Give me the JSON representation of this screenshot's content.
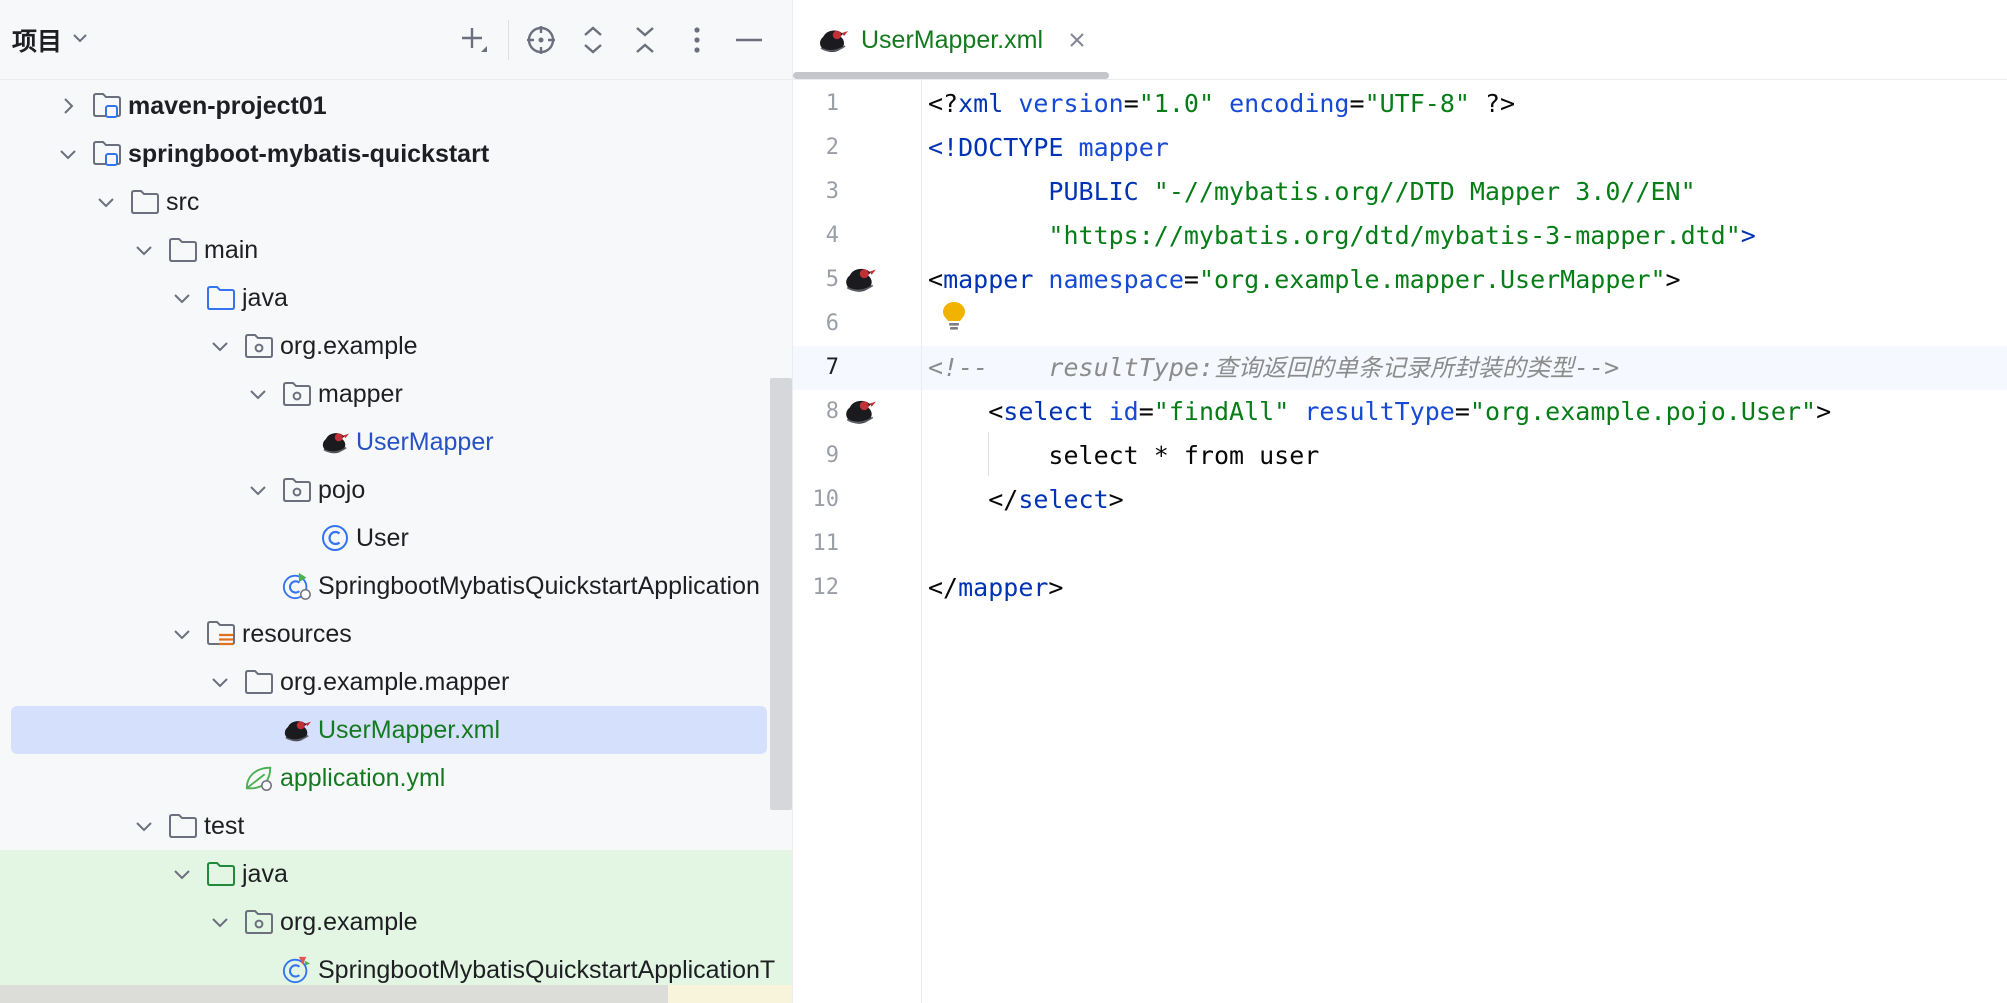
{
  "project_panel": {
    "title": "项目",
    "toolbar": [
      {
        "name": "add-icon"
      },
      {
        "name": "locate-icon"
      },
      {
        "name": "expand-all-icon"
      },
      {
        "name": "collapse-all-icon"
      },
      {
        "name": "more-options-icon"
      },
      {
        "name": "minimize-icon"
      }
    ],
    "tree": [
      {
        "label": "maven-project01",
        "depth": 0,
        "expand": "collapsed",
        "icon": "module-folder-icon",
        "style": "bold"
      },
      {
        "label": "springboot-mybatis-quickstart",
        "depth": 0,
        "expand": "expanded",
        "icon": "module-folder-icon",
        "style": "bold"
      },
      {
        "label": "src",
        "depth": 1,
        "expand": "expanded",
        "icon": "folder-icon",
        "style": "normal"
      },
      {
        "label": "main",
        "depth": 2,
        "expand": "expanded",
        "icon": "folder-icon",
        "style": "normal"
      },
      {
        "label": "java",
        "depth": 3,
        "expand": "expanded",
        "icon": "source-folder-icon",
        "style": "normal"
      },
      {
        "label": "org.example",
        "depth": 4,
        "expand": "expanded",
        "icon": "package-icon",
        "style": "normal"
      },
      {
        "label": "mapper",
        "depth": 5,
        "expand": "expanded",
        "icon": "package-icon",
        "style": "normal"
      },
      {
        "label": "UserMapper",
        "depth": 6,
        "expand": "none",
        "icon": "mybatis-bird-icon",
        "style": "blue"
      },
      {
        "label": "pojo",
        "depth": 5,
        "expand": "expanded",
        "icon": "package-icon",
        "style": "normal"
      },
      {
        "label": "User",
        "depth": 6,
        "expand": "none",
        "icon": "class-icon",
        "style": "normal"
      },
      {
        "label": "SpringbootMybatisQuickstartApplication",
        "depth": 5,
        "expand": "none",
        "icon": "spring-boot-class-icon",
        "style": "normal"
      },
      {
        "label": "resources",
        "depth": 3,
        "expand": "expanded",
        "icon": "resources-folder-icon",
        "style": "normal"
      },
      {
        "label": "org.example.mapper",
        "depth": 4,
        "expand": "expanded",
        "icon": "folder-icon",
        "style": "normal"
      },
      {
        "label": "UserMapper.xml",
        "depth": 5,
        "expand": "none",
        "icon": "mybatis-bird-icon",
        "style": "green",
        "selected": true
      },
      {
        "label": "application.yml",
        "depth": 4,
        "expand": "none",
        "icon": "spring-config-icon",
        "style": "green"
      },
      {
        "label": "test",
        "depth": 2,
        "expand": "expanded",
        "icon": "folder-icon",
        "style": "normal"
      },
      {
        "label": "java",
        "depth": 3,
        "expand": "expanded",
        "icon": "test-folder-icon",
        "style": "normal",
        "highlight": "green"
      },
      {
        "label": "org.example",
        "depth": 4,
        "expand": "expanded",
        "icon": "package-icon",
        "style": "normal",
        "highlight": "green"
      },
      {
        "label": "SpringbootMybatisQuickstartApplicationT",
        "depth": 5,
        "expand": "none",
        "icon": "spring-boot-test-icon",
        "style": "normal",
        "highlight": "green"
      }
    ]
  },
  "editor": {
    "tab": {
      "label": "UserMapper.xml",
      "close": "close-icon"
    },
    "current_line": 7,
    "lines": [
      {
        "n": "1",
        "tokens": [
          {
            "t": "<?",
            "c": ""
          },
          {
            "t": "xml ",
            "c": "tag"
          },
          {
            "t": "version",
            "c": "attr"
          },
          {
            "t": "=",
            "c": ""
          },
          {
            "t": "\"1.0\"",
            "c": "val"
          },
          {
            "t": " ",
            "c": ""
          },
          {
            "t": "encoding",
            "c": "attr"
          },
          {
            "t": "=",
            "c": ""
          },
          {
            "t": "\"UTF-8\"",
            "c": "val"
          },
          {
            "t": " ?>",
            "c": ""
          }
        ]
      },
      {
        "n": "2",
        "tokens": [
          {
            "t": "<!DOCTYPE ",
            "c": "tag"
          },
          {
            "t": "mapper",
            "c": "attr"
          }
        ]
      },
      {
        "n": "3",
        "tokens": [
          {
            "t": "        PUBLIC ",
            "c": "tag"
          },
          {
            "t": "\"-//mybatis.org//DTD Mapper 3.0//EN\"",
            "c": "val"
          }
        ]
      },
      {
        "n": "4",
        "tokens": [
          {
            "t": "        ",
            "c": ""
          },
          {
            "t": "\"https://mybatis.org/dtd/mybatis-3-mapper.dtd\"",
            "c": "val"
          },
          {
            "t": ">",
            "c": "tag"
          }
        ]
      },
      {
        "n": "5",
        "gutter_icon": "mybatis-bird-icon",
        "tokens": [
          {
            "t": "<",
            "c": ""
          },
          {
            "t": "mapper ",
            "c": "tag"
          },
          {
            "t": "namespace",
            "c": "attr"
          },
          {
            "t": "=",
            "c": ""
          },
          {
            "t": "\"org.example.mapper.UserMapper\"",
            "c": "val"
          },
          {
            "t": ">",
            "c": ""
          }
        ]
      },
      {
        "n": "6",
        "tokens": []
      },
      {
        "n": "7",
        "tokens": [
          {
            "t": "<!--    resultType:",
            "c": "cmt"
          },
          {
            "t": "查询返回的单条记录所封装的类型",
            "c": "cmt-cjk"
          },
          {
            "t": "-->",
            "c": "cmt"
          }
        ]
      },
      {
        "n": "8",
        "gutter_icon": "mybatis-bird-icon",
        "tokens": [
          {
            "t": "    <",
            "c": ""
          },
          {
            "t": "select ",
            "c": "tag"
          },
          {
            "t": "id",
            "c": "attr"
          },
          {
            "t": "=",
            "c": ""
          },
          {
            "t": "\"findAll\"",
            "c": "val"
          },
          {
            "t": " ",
            "c": ""
          },
          {
            "t": "resultType",
            "c": "attr"
          },
          {
            "t": "=",
            "c": ""
          },
          {
            "t": "\"org.example.pojo.User\"",
            "c": "val"
          },
          {
            "t": ">",
            "c": ""
          }
        ]
      },
      {
        "n": "9",
        "tokens": [
          {
            "t": "        select * from user",
            "c": ""
          }
        ]
      },
      {
        "n": "10",
        "tokens": [
          {
            "t": "    </",
            "c": ""
          },
          {
            "t": "select",
            "c": "tag"
          },
          {
            "t": ">",
            "c": ""
          }
        ]
      },
      {
        "n": "11",
        "tokens": []
      },
      {
        "n": "12",
        "tokens": [
          {
            "t": "</",
            "c": ""
          },
          {
            "t": "mapper",
            "c": "tag"
          },
          {
            "t": ">",
            "c": ""
          }
        ]
      }
    ],
    "intention_icon": "lightbulb-icon"
  },
  "colors": {
    "tag": "#0033b3",
    "attribute": "#174ad4",
    "string": "#067d17",
    "comment": "#8c8c8c",
    "selection": "#d5e1fc",
    "test_highlight": "#e3f5e3",
    "accent_green_text": "#157a1f",
    "accent_blue_text": "#2752c3"
  }
}
